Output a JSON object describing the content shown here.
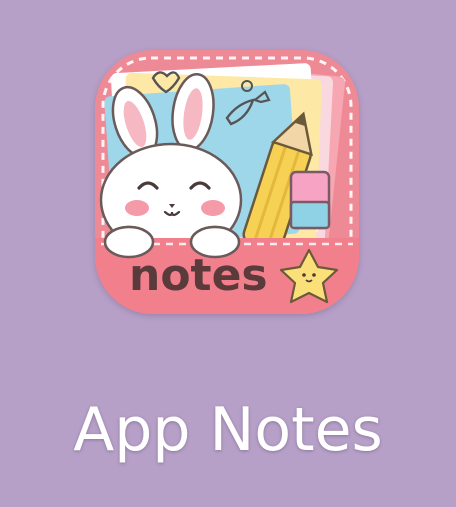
{
  "app": {
    "label": "App Notes",
    "icon_word": "notes",
    "icon_name": "bunny-notebook-app-icon"
  },
  "colors": {
    "background": "#b6a0c8",
    "icon_pink": "#ef8a96",
    "icon_pocket": "#f27f8c",
    "label": "#ffffff"
  }
}
